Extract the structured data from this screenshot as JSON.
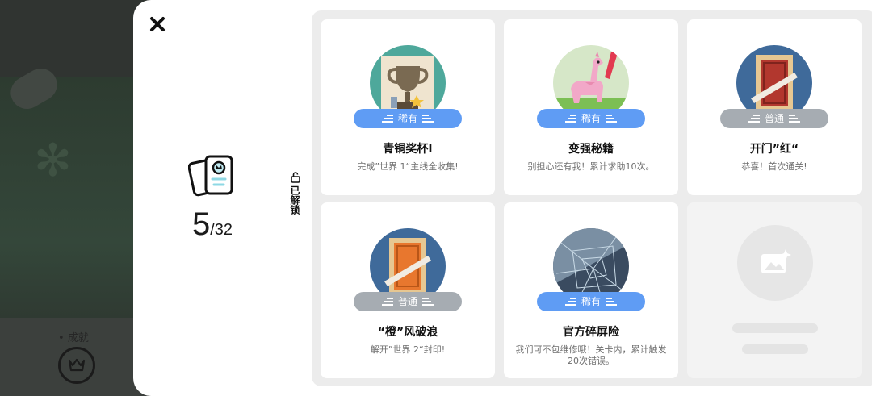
{
  "background": {
    "achievement_label": "• 成就",
    "achievement_icon": "crown-icon"
  },
  "modal": {
    "close_icon": "close-icon",
    "summary": {
      "icon": "achievement-card-icon",
      "unlocked_count": "5",
      "total_count": "/32"
    },
    "unlocked_label": "已解锁",
    "colors": {
      "rare": "#5f9cf4",
      "normal": "#a6acb2"
    },
    "cards": [
      {
        "title": "青铜奖杯I",
        "badge": "稀有",
        "desc": "完成”世界 1“主线全收集!"
      },
      {
        "title": "变强秘籍",
        "badge": "稀有",
        "desc": "别担心还有我！累计求助10次。"
      },
      {
        "title": "开门”红“",
        "badge": "普通",
        "desc": "恭喜！首次通关!"
      },
      {
        "title": "“橙”风破浪",
        "badge": "普通",
        "desc": "解开”世界 2“封印!"
      },
      {
        "title": "官方碎屏险",
        "badge": "稀有",
        "desc": "我们可不包维修哦！关卡内，累计触发20次错误。"
      },
      {
        "title": "",
        "badge": "",
        "desc": ""
      }
    ]
  }
}
